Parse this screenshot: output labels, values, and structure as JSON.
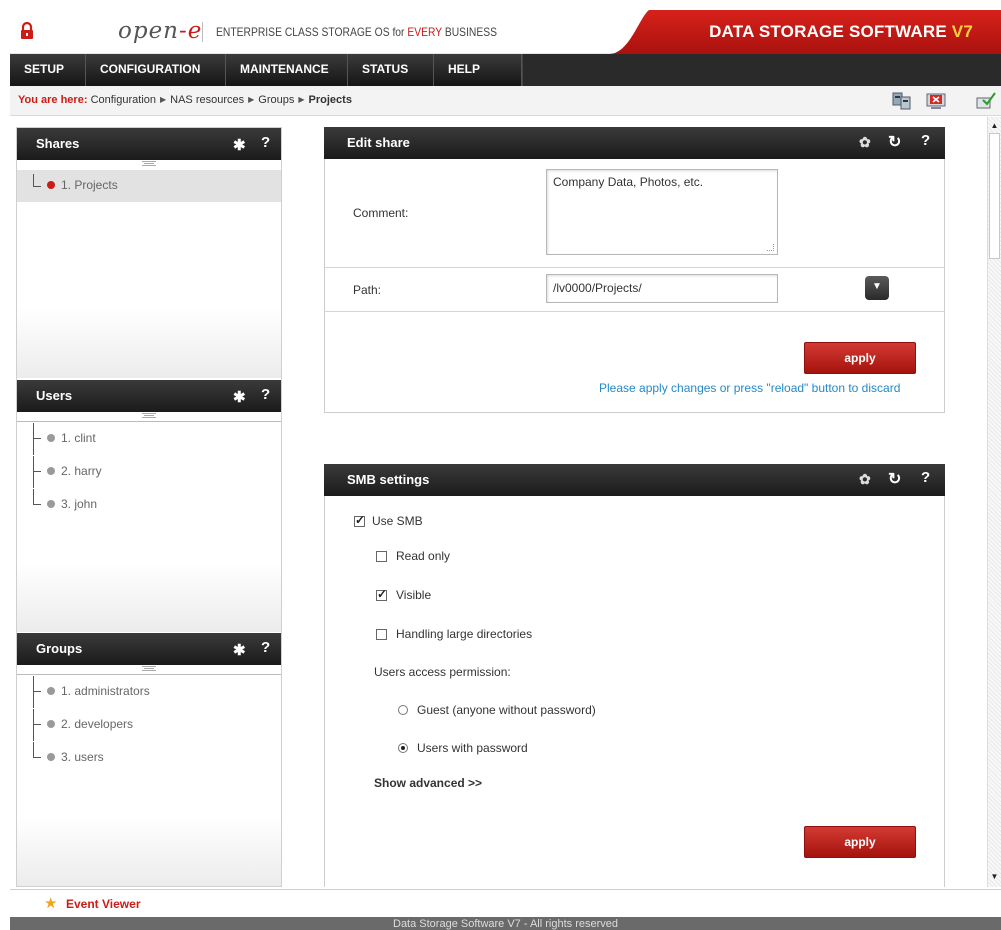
{
  "header": {
    "logo_text_main": "open",
    "logo_text_dash": "-e",
    "tagline_prefix": "ENTERPRISE CLASS STORAGE OS for ",
    "tagline_emph": "EVERY",
    "tagline_suffix": " BUSINESS",
    "brand_main": "DATA STORAGE SOFTWARE ",
    "brand_version": "V7",
    "accent_color": "#cc1c16"
  },
  "menu": {
    "items": [
      {
        "label": "SETUP"
      },
      {
        "label": "CONFIGURATION"
      },
      {
        "label": "MAINTENANCE"
      },
      {
        "label": "STATUS"
      },
      {
        "label": "HELP"
      }
    ]
  },
  "breadcrumb": {
    "prefix": "You are here:",
    "items": [
      "Configuration",
      "NAS resources",
      "Groups"
    ],
    "current": "Projects"
  },
  "toolbar_icons": [
    "network-icon",
    "logout-icon",
    "save-config-icon"
  ],
  "shares_panel": {
    "title": "Shares",
    "items": [
      {
        "label": "1. Projects",
        "selected": true
      }
    ]
  },
  "users_panel": {
    "title": "Users",
    "items": [
      {
        "label": "1. clint"
      },
      {
        "label": "2. harry"
      },
      {
        "label": "3. john"
      }
    ]
  },
  "groups_panel": {
    "title": "Groups",
    "items": [
      {
        "label": "1. administrators"
      },
      {
        "label": "2. developers"
      },
      {
        "label": "3. users"
      }
    ]
  },
  "edit_share": {
    "title": "Edit share",
    "comment_label": "Comment:",
    "comment_value": "Company Data, Photos, etc.",
    "path_label": "Path:",
    "path_value": "/lv0000/Projects/",
    "apply_label": "apply",
    "notice": "Please apply changes or press \"reload\" button to discard"
  },
  "smb_settings": {
    "title": "SMB settings",
    "use_smb": {
      "label": "Use SMB",
      "checked": true
    },
    "read_only": {
      "label": "Read only",
      "checked": false
    },
    "visible": {
      "label": "Visible",
      "checked": true
    },
    "large_dirs": {
      "label": "Handling large directories",
      "checked": false
    },
    "access_label": "Users access permission:",
    "guest": {
      "label": "Guest (anyone without password)",
      "selected": false
    },
    "users_with_password": {
      "label": "Users with password",
      "selected": true
    },
    "show_advanced": "Show advanced >>",
    "apply_label": "apply"
  },
  "event_viewer": {
    "label": "Event Viewer"
  },
  "footer": {
    "text": "Data Storage Software V7 - All rights reserved"
  }
}
